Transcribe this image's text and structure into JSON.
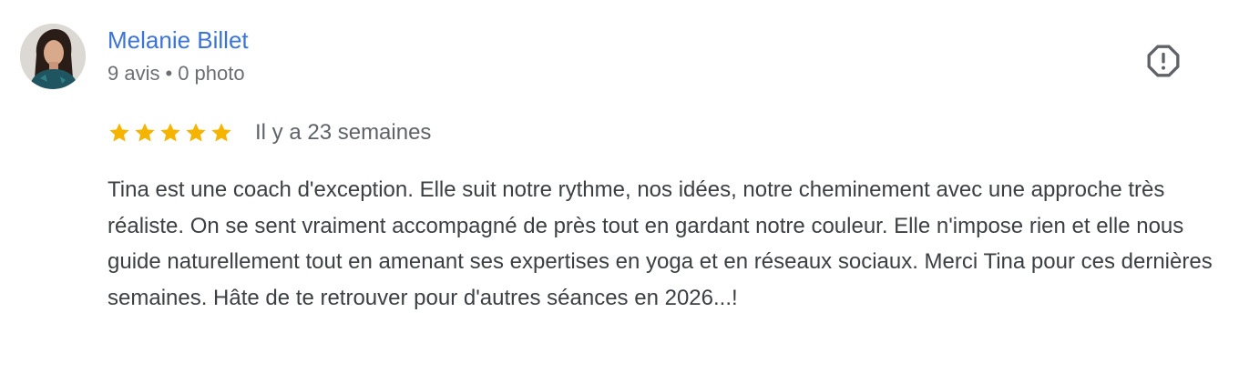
{
  "review": {
    "author": {
      "name": "Melanie Billet",
      "review_count": "9 avis",
      "separator": "•",
      "photo_count": "0 photo",
      "avatar_icon": "profile-photo"
    },
    "rating": {
      "stars": 5,
      "max_stars": 5,
      "star_icon": "star-icon",
      "color": "#f4b400"
    },
    "date": "Il y a 23 semaines",
    "text": "Tina est une coach d'exception. Elle suit notre rythme, nos idées, notre cheminement avec une approche très réaliste. On se sent vraiment accompagné de près tout en gardant notre couleur. Elle n'impose rien et elle nous guide naturellement tout en amenant ses expertises en yoga et en réseaux sociaux. Merci Tina pour ces dernières semaines. Hâte de te retrouver pour d'autres séances en 2026...!",
    "report_icon": "report-flag-icon"
  },
  "colors": {
    "author_name": "#3c73d8",
    "meta": "#6b6f74",
    "body_text": "#3c4043",
    "icon": "#5f6368"
  }
}
